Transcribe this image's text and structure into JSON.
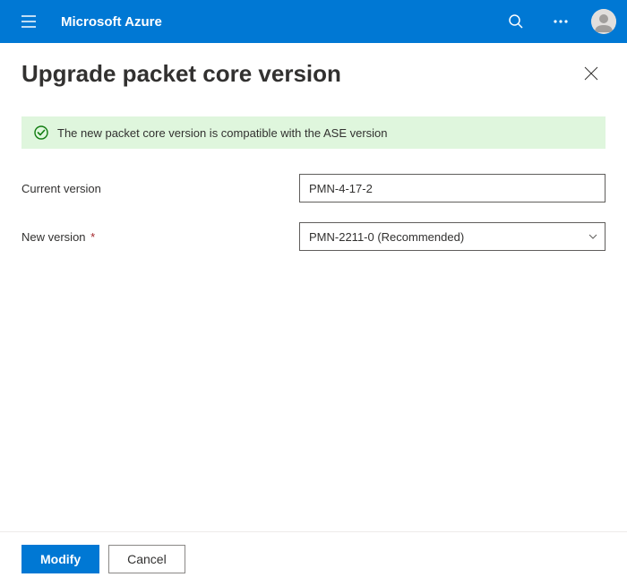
{
  "header": {
    "brand": "Microsoft Azure"
  },
  "panel": {
    "title": "Upgrade packet core version"
  },
  "info": {
    "message": "The new packet core version is compatible with the ASE version"
  },
  "form": {
    "current_version": {
      "label": "Current version",
      "value": "PMN-4-17-2"
    },
    "new_version": {
      "label": "New version",
      "selected": "PMN-2211-0 (Recommended)"
    }
  },
  "footer": {
    "modify_label": "Modify",
    "cancel_label": "Cancel"
  }
}
